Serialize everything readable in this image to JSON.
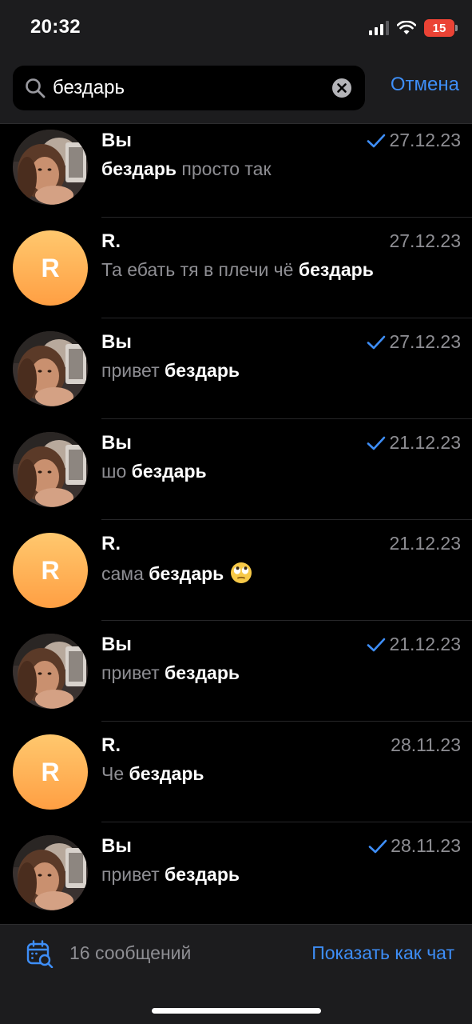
{
  "status_bar": {
    "time": "20:32",
    "battery": "15"
  },
  "search": {
    "query": "бездарь",
    "cancel_label": "Отмена"
  },
  "results": [
    {
      "sender": "Вы",
      "date": "27.12.23",
      "sent": true,
      "avatar": "photo",
      "pre": "",
      "match": "бездарь",
      "post": " просто так",
      "emoji": ""
    },
    {
      "sender": "R.",
      "date": "27.12.23",
      "sent": false,
      "avatar": "R",
      "pre": "Та ебать тя в плечи чё ",
      "match": "бездарь",
      "post": "",
      "emoji": ""
    },
    {
      "sender": "Вы",
      "date": "27.12.23",
      "sent": true,
      "avatar": "photo",
      "pre": "привет ",
      "match": "бездарь",
      "post": "",
      "emoji": ""
    },
    {
      "sender": "Вы",
      "date": "21.12.23",
      "sent": true,
      "avatar": "photo",
      "pre": "шо ",
      "match": "бездарь",
      "post": "",
      "emoji": ""
    },
    {
      "sender": "R.",
      "date": "21.12.23",
      "sent": false,
      "avatar": "R",
      "pre": "сама ",
      "match": "бездарь",
      "post": "",
      "emoji": "eye-roll-emoji"
    },
    {
      "sender": "Вы",
      "date": "21.12.23",
      "sent": true,
      "avatar": "photo",
      "pre": "привет ",
      "match": "бездарь",
      "post": "",
      "emoji": ""
    },
    {
      "sender": "R.",
      "date": "28.11.23",
      "sent": false,
      "avatar": "R",
      "pre": "Че ",
      "match": "бездарь",
      "post": "",
      "emoji": ""
    },
    {
      "sender": "Вы",
      "date": "28.11.23",
      "sent": true,
      "avatar": "photo",
      "pre": "привет ",
      "match": "бездарь",
      "post": "",
      "emoji": ""
    }
  ],
  "footer": {
    "count_label": "16 сообщений",
    "show_as_chat_label": "Показать как чат"
  },
  "colors": {
    "accent": "#3e8ef7",
    "secondary_text": "#8e8e93",
    "avatar_orange": "#ffb057",
    "battery_red": "#eb4335"
  }
}
